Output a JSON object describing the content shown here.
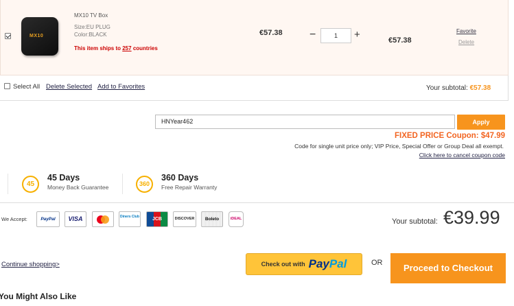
{
  "item": {
    "name": "MX10 TV Box",
    "image_text": "MX10",
    "size": "Size:EU PLUG",
    "color": "Color:BLACK",
    "ships_prefix": "This item ships to ",
    "ships_count": "257",
    "ships_suffix": " countries",
    "unit_price": "€57.38",
    "quantity": "1",
    "minus": "−",
    "plus": "+",
    "line_total": "€57.38",
    "favorite": "Favorite",
    "delete": "Delete"
  },
  "cart_actions": {
    "select_all": "Select All",
    "delete_selected": "Delete Selected",
    "add_to_favorites": "Add to Favorites",
    "subtotal_label": "Your subtotal: ",
    "subtotal_value": "€57.38"
  },
  "coupon": {
    "code": "HNYear462",
    "apply": "Apply",
    "fixed_text": "FIXED PRICE Coupon: $47.99",
    "note": "Code for single unit price only; VIP Price, Special Offer or Group Deal all exempt.",
    "cancel": "Click here to cancel coupon code"
  },
  "guarantees": [
    {
      "badge": "45",
      "title": "45 Days",
      "sub": "Money Back Guarantee"
    },
    {
      "badge": "360",
      "title": "360 Days",
      "sub": "Free Repair Warranty"
    }
  ],
  "payment": {
    "label": "We Accept:",
    "cards": [
      "PayPal",
      "VISA",
      "MasterCard",
      "Diners Club",
      "JCB",
      "DISCOVER",
      "Boleto",
      "iDEAL"
    ],
    "subtotal_label": "Your subtotal:",
    "subtotal_value": "€39.99"
  },
  "checkout": {
    "continue": "Continue shopping>",
    "paypal_prefix": "Check out with",
    "paypal_pay": "Pay",
    "paypal_pal": "Pal",
    "or": "OR",
    "proceed": "Proceed to Checkout"
  },
  "recommend": {
    "title": "You Might Also Like"
  },
  "colors": {
    "accent": "#f7941d",
    "coupon": "#f26522",
    "item_bg": "#fff7f2",
    "paypal_yellow": "#ffc439"
  }
}
